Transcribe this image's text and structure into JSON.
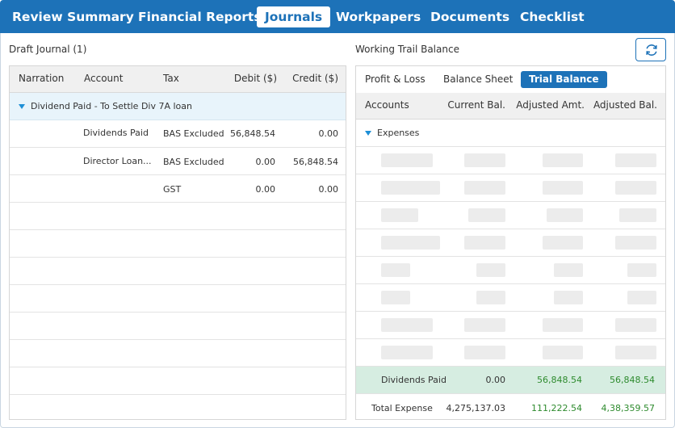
{
  "nav": {
    "tabs": [
      {
        "label": "Review Summary"
      },
      {
        "label": "Financial Reports"
      },
      {
        "label": "Journals"
      },
      {
        "label": "Workpapers"
      },
      {
        "label": "Documents"
      },
      {
        "label": "Checklist"
      }
    ],
    "active_tab": "Journals"
  },
  "draft_journal": {
    "title": "Draft Journal (1)",
    "columns": [
      "Narration",
      "Account",
      "Tax",
      "Debit ($)",
      "Credit ($)"
    ],
    "group": {
      "label": "Dividend Paid - To Settle Div 7A loan",
      "expanded": true
    },
    "rows": [
      {
        "narration": "",
        "account": "Dividends Paid",
        "tax": "BAS Excluded",
        "debit": "56,848.54",
        "credit": "0.00"
      },
      {
        "narration": "",
        "account": "Director Loan...",
        "tax": "BAS Excluded",
        "debit": "0.00",
        "credit": "56,848.54"
      },
      {
        "narration": "",
        "account": "",
        "tax": "GST",
        "debit": "0.00",
        "credit": "0.00"
      }
    ]
  },
  "trial_balance": {
    "title": "Working Trail Balance",
    "refresh_icon": "refresh-icon",
    "subtabs": [
      {
        "label": "Profit & Loss"
      },
      {
        "label": "Balance Sheet"
      },
      {
        "label": "Trial Balance"
      }
    ],
    "active_subtab": "Trial Balance",
    "columns": [
      "Accounts",
      "Current Bal.",
      "Adjusted Amt.",
      "Adjusted Bal."
    ],
    "group": {
      "label": "Expenses",
      "expanded": true
    },
    "highlight_row": {
      "account": "Dividends Paid",
      "current": "0.00",
      "adjusted_amt": "56,848.54",
      "adjusted_bal": "56,848.54"
    },
    "total_row": {
      "account": "Total Expense",
      "current": "4,275,137.03",
      "adjusted_amt": "111,222.54",
      "adjusted_bal": "4,38,359.57"
    }
  },
  "colors": {
    "brand": "#1d72b8",
    "caret": "#1d8fd6",
    "positive": "#2e8b2e",
    "highlight": "#d6ede1",
    "group_bg": "#e8f4fb"
  }
}
